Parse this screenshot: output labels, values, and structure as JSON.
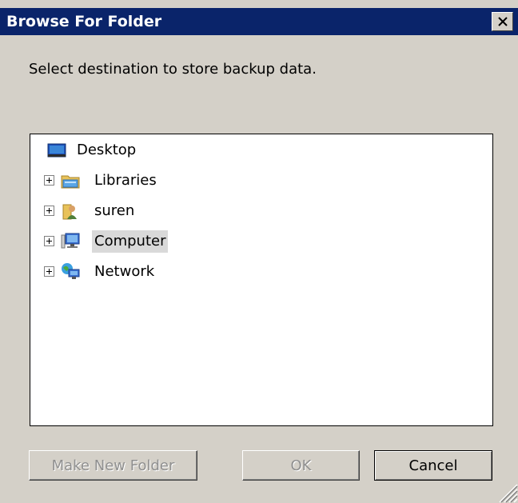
{
  "window": {
    "title": "Browse For Folder"
  },
  "prompt": "Select destination to store backup data.",
  "tree": {
    "items": [
      {
        "label": "Desktop",
        "icon": "desktop-icon",
        "expandable": false,
        "selected": false
      },
      {
        "label": "Libraries",
        "icon": "libraries-folder-icon",
        "expandable": true,
        "selected": false
      },
      {
        "label": "suren",
        "icon": "user-folder-icon",
        "expandable": true,
        "selected": false
      },
      {
        "label": "Computer",
        "icon": "computer-icon",
        "expandable": true,
        "selected": true
      },
      {
        "label": "Network",
        "icon": "network-icon",
        "expandable": true,
        "selected": false
      }
    ]
  },
  "buttons": {
    "make_new_folder": "Make New Folder",
    "ok": "OK",
    "cancel": "Cancel"
  },
  "colors": {
    "titlebar": "#0a246a",
    "dialog_bg": "#d4d0c8",
    "selection": "#d9d9d9",
    "disabled_text": "#8f8f8f"
  }
}
